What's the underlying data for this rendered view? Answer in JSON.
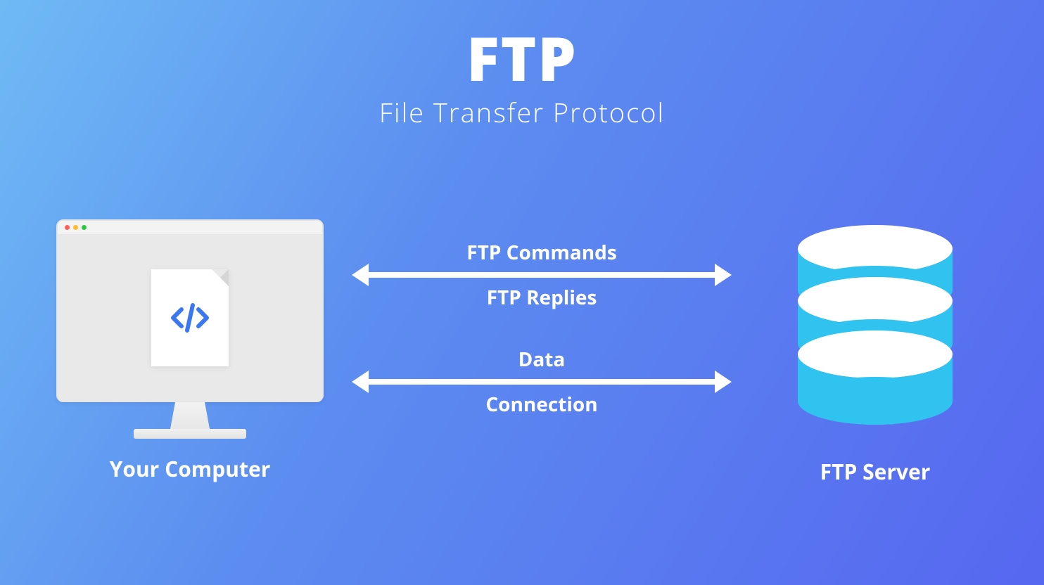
{
  "title": {
    "main": "FTP",
    "sub": "File Transfer Protocol"
  },
  "client": {
    "label": "Your Computer",
    "icon": "code-file-icon"
  },
  "server": {
    "label": "FTP Server",
    "icon": "database-icon"
  },
  "connections": [
    {
      "top_label": "FTP Commands",
      "bottom_label": "FTP Replies",
      "direction": "bidirectional"
    },
    {
      "top_label": "Data",
      "bottom_label": "Connection",
      "direction": "bidirectional"
    }
  ],
  "colors": {
    "accent": "#31c3ef",
    "text": "#ffffff",
    "code_icon": "#3a78f2"
  }
}
